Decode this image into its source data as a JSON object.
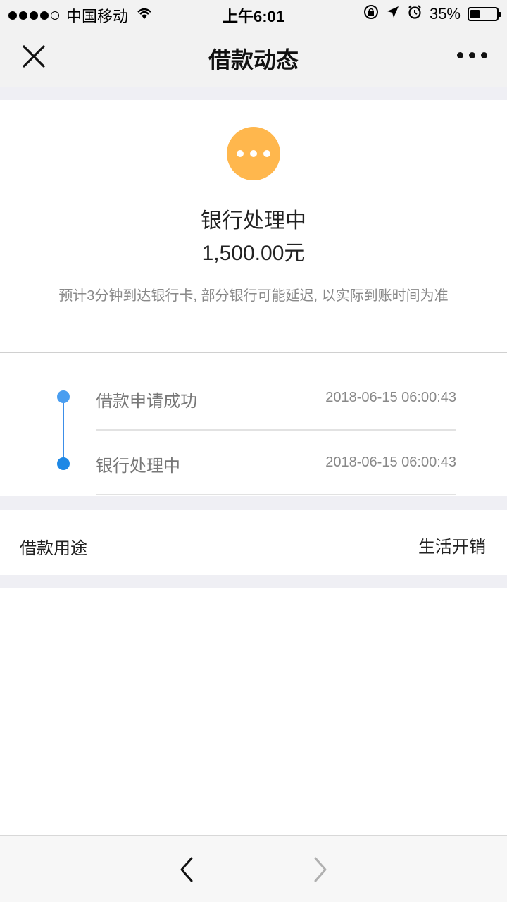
{
  "status_bar": {
    "carrier": "中国移动",
    "time": "上午6:01",
    "battery": "35%",
    "battery_level": 0.35
  },
  "nav": {
    "title": "借款动态"
  },
  "status": {
    "title": "银行处理中",
    "amount": "1,500.00元",
    "notice": "预计3分钟到达银行卡, 部分银行可能延迟, 以实际到账时间为准",
    "icon_color": "#ffb74d"
  },
  "timeline": [
    {
      "label": "借款申请成功",
      "time": "2018-06-15 06:00:43"
    },
    {
      "label": "银行处理中",
      "time": "2018-06-15 06:00:43"
    }
  ],
  "purpose": {
    "label": "借款用途",
    "value": "生活开销"
  },
  "colors": {
    "accent_blue": "#1e88e5",
    "pending_orange": "#ffb74d"
  }
}
